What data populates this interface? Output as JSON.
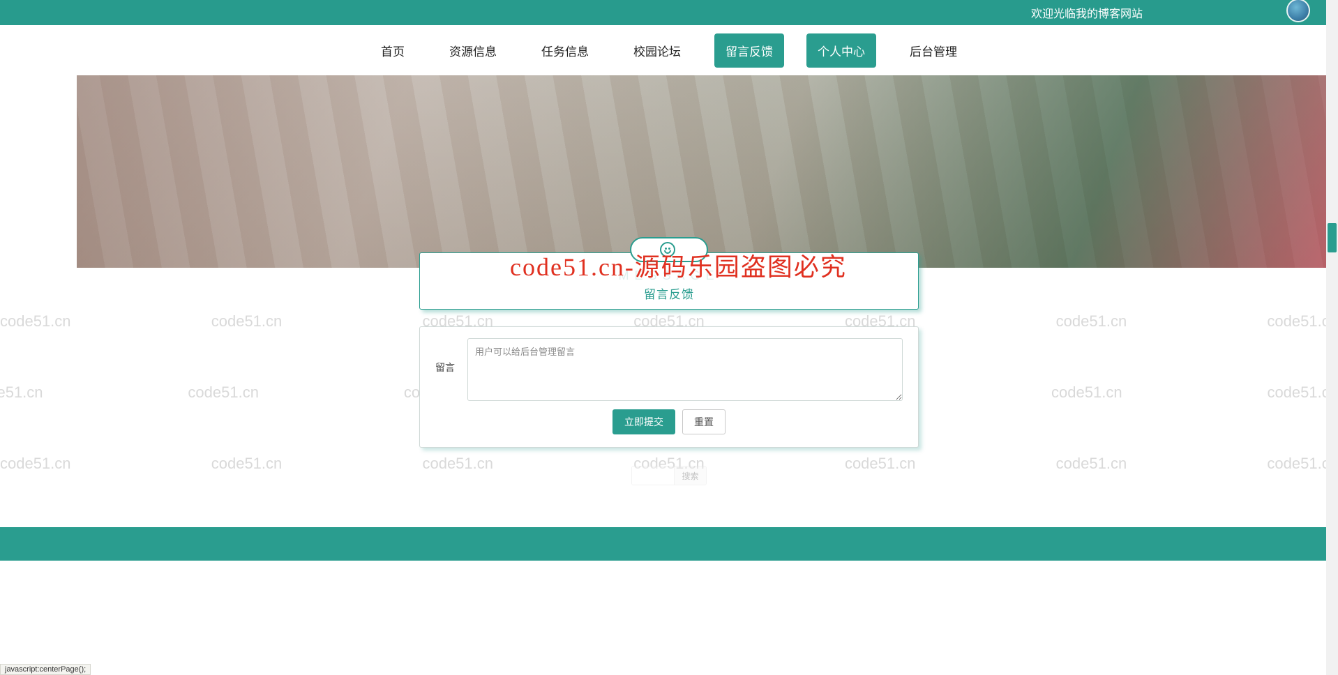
{
  "top_bar": {
    "welcome": "欢迎光临我的博客网站"
  },
  "nav": {
    "items": [
      {
        "label": "首页"
      },
      {
        "label": "资源信息"
      },
      {
        "label": "任务信息"
      },
      {
        "label": "校园论坛"
      },
      {
        "label": "留言反馈"
      },
      {
        "label": "个人中心"
      },
      {
        "label": "后台管理"
      }
    ]
  },
  "title": {
    "main": "MESSAGE",
    "sub": "留言反馈"
  },
  "form": {
    "label": "留言",
    "placeholder": "用户可以给后台管理留言",
    "value": "",
    "submit": "立即提交",
    "reset": "重置"
  },
  "search": {
    "placeholder": "",
    "btn": "搜索"
  },
  "overlay": {
    "red_text": "code51.cn-源码乐园盗图必究"
  },
  "watermark": "code51.cn",
  "status": "javascript:centerPage();"
}
